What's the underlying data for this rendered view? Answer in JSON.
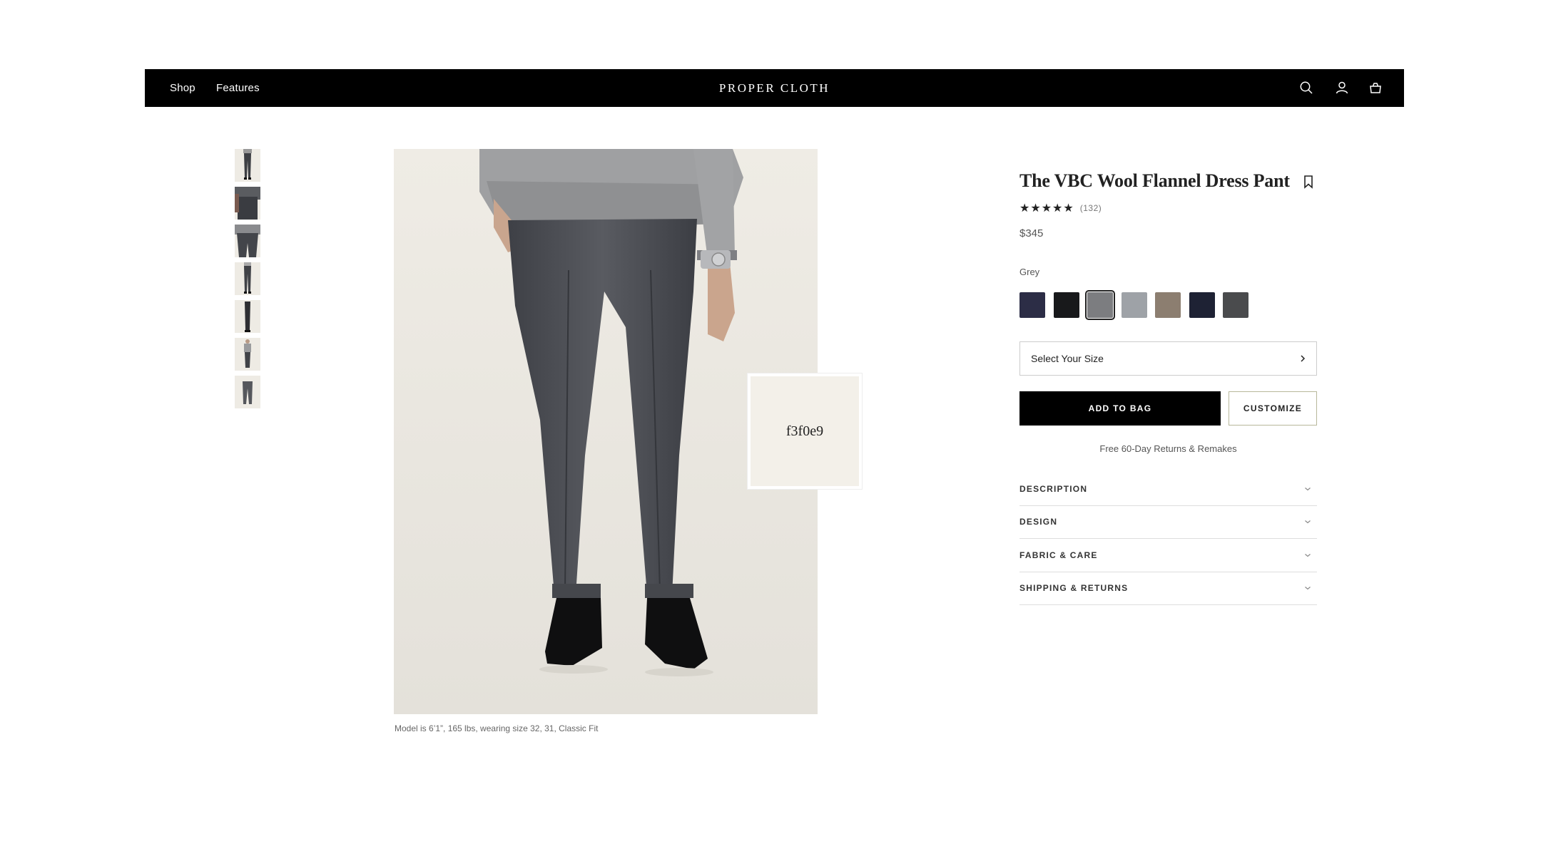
{
  "nav": {
    "shop": "Shop",
    "features": "Features",
    "brand": "PROPER CLOTH",
    "icons": [
      "search-icon",
      "account-icon",
      "bag-icon"
    ]
  },
  "gallery": {
    "thumbnail_count": 7,
    "caption": "Model is 6’1”, 165 lbs, wearing size 32, 31, Classic Fit",
    "swatch_preview_label": "f3f0e9"
  },
  "product": {
    "title": "The VBC Wool Flannel Dress Pant",
    "stars": "★★★★★",
    "rating": 5,
    "review_count": "(132)",
    "price": "$345",
    "color_label": "Grey",
    "swatches": [
      {
        "name": "navy",
        "color": "#2c2d46"
      },
      {
        "name": "black",
        "color": "#18191b"
      },
      {
        "name": "grey",
        "color": "#7c7d80",
        "selected": true
      },
      {
        "name": "light-grey",
        "color": "#9ea2a7"
      },
      {
        "name": "taupe",
        "color": "#8c7e70"
      },
      {
        "name": "midnight",
        "color": "#1e2234"
      },
      {
        "name": "charcoal",
        "color": "#4a4b4d"
      }
    ],
    "size_select": "Select Your Size",
    "add_to_bag": "ADD TO BAG",
    "customize": "CUSTOMIZE",
    "returns_note": "Free 60-Day Returns & Remakes",
    "accordion": [
      {
        "label": "DESCRIPTION"
      },
      {
        "label": "DESIGN"
      },
      {
        "label": "FABRIC & CARE"
      },
      {
        "label": "SHIPPING & RETURNS"
      }
    ]
  },
  "colors": {
    "nav_bg": "#000000",
    "image_bg": "#efece5",
    "accent_border": "#b7b79a"
  }
}
